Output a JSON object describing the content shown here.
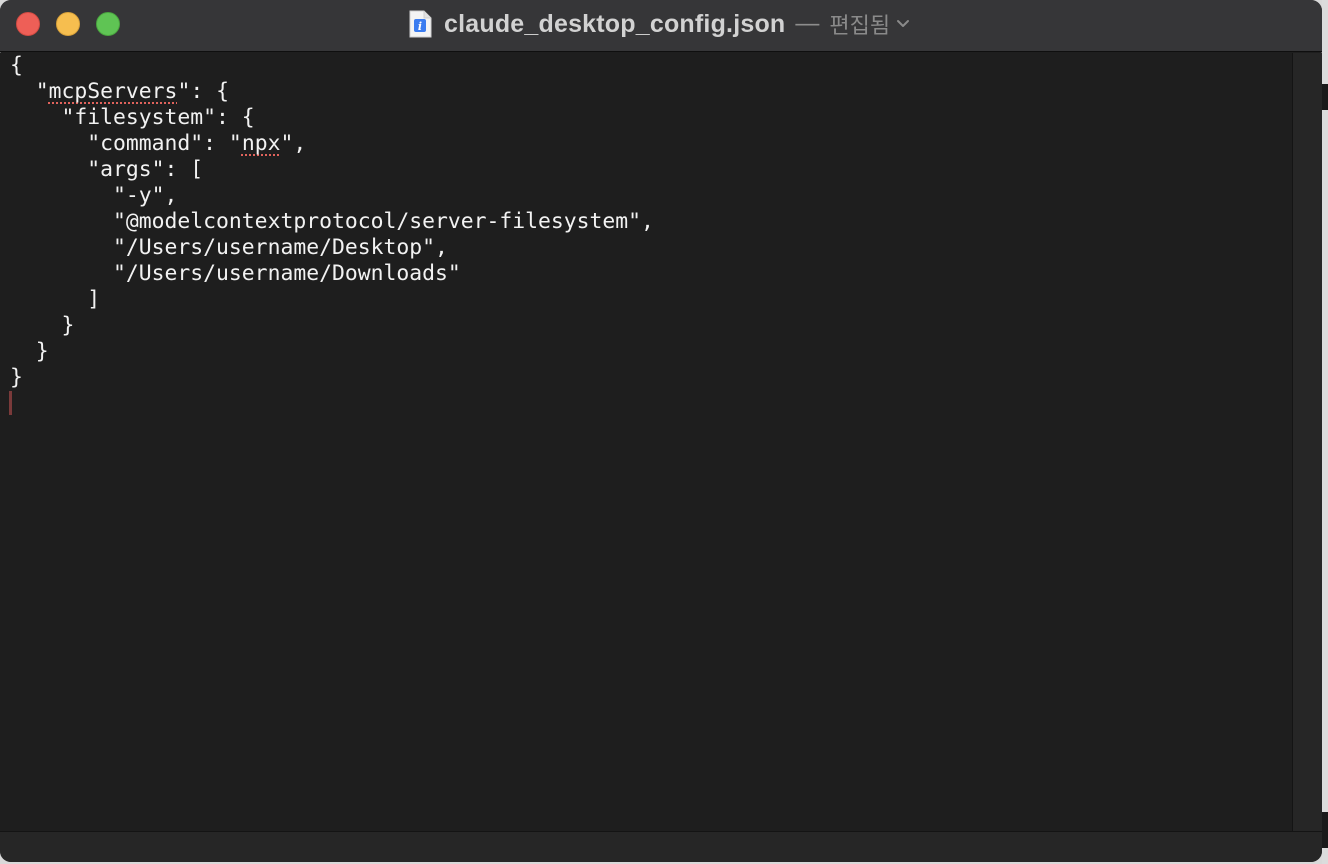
{
  "window": {
    "filename": "claude_desktop_config.json",
    "separator": "—",
    "status": "편집됨"
  },
  "editor": {
    "lines": [
      "{",
      "  \"mcpServers\": {",
      "    \"filesystem\": {",
      "      \"command\": \"npx\",",
      "      \"args\": [",
      "        \"-y\",",
      "        \"@modelcontextprotocol/server-filesystem\",",
      "        \"/Users/username/Desktop\",",
      "        \"/Users/username/Downloads\"",
      "      ]",
      "    }",
      "  }",
      "}"
    ],
    "misspelled_words": [
      "mcpServers",
      "npx"
    ]
  },
  "icons": {
    "close": "close-traffic-light",
    "minimize": "minimize-traffic-light",
    "zoom": "zoom-traffic-light",
    "document": "json-document-icon",
    "title_menu": "chevron-down-icon"
  },
  "colors": {
    "editor_background": "#1e1e1e",
    "text": "#f2f2f2",
    "titlebar": "#363638",
    "close": "#ee5f57",
    "minimize": "#f6be4f",
    "zoom": "#5fc454",
    "spelling_underline": "#e0635c"
  }
}
